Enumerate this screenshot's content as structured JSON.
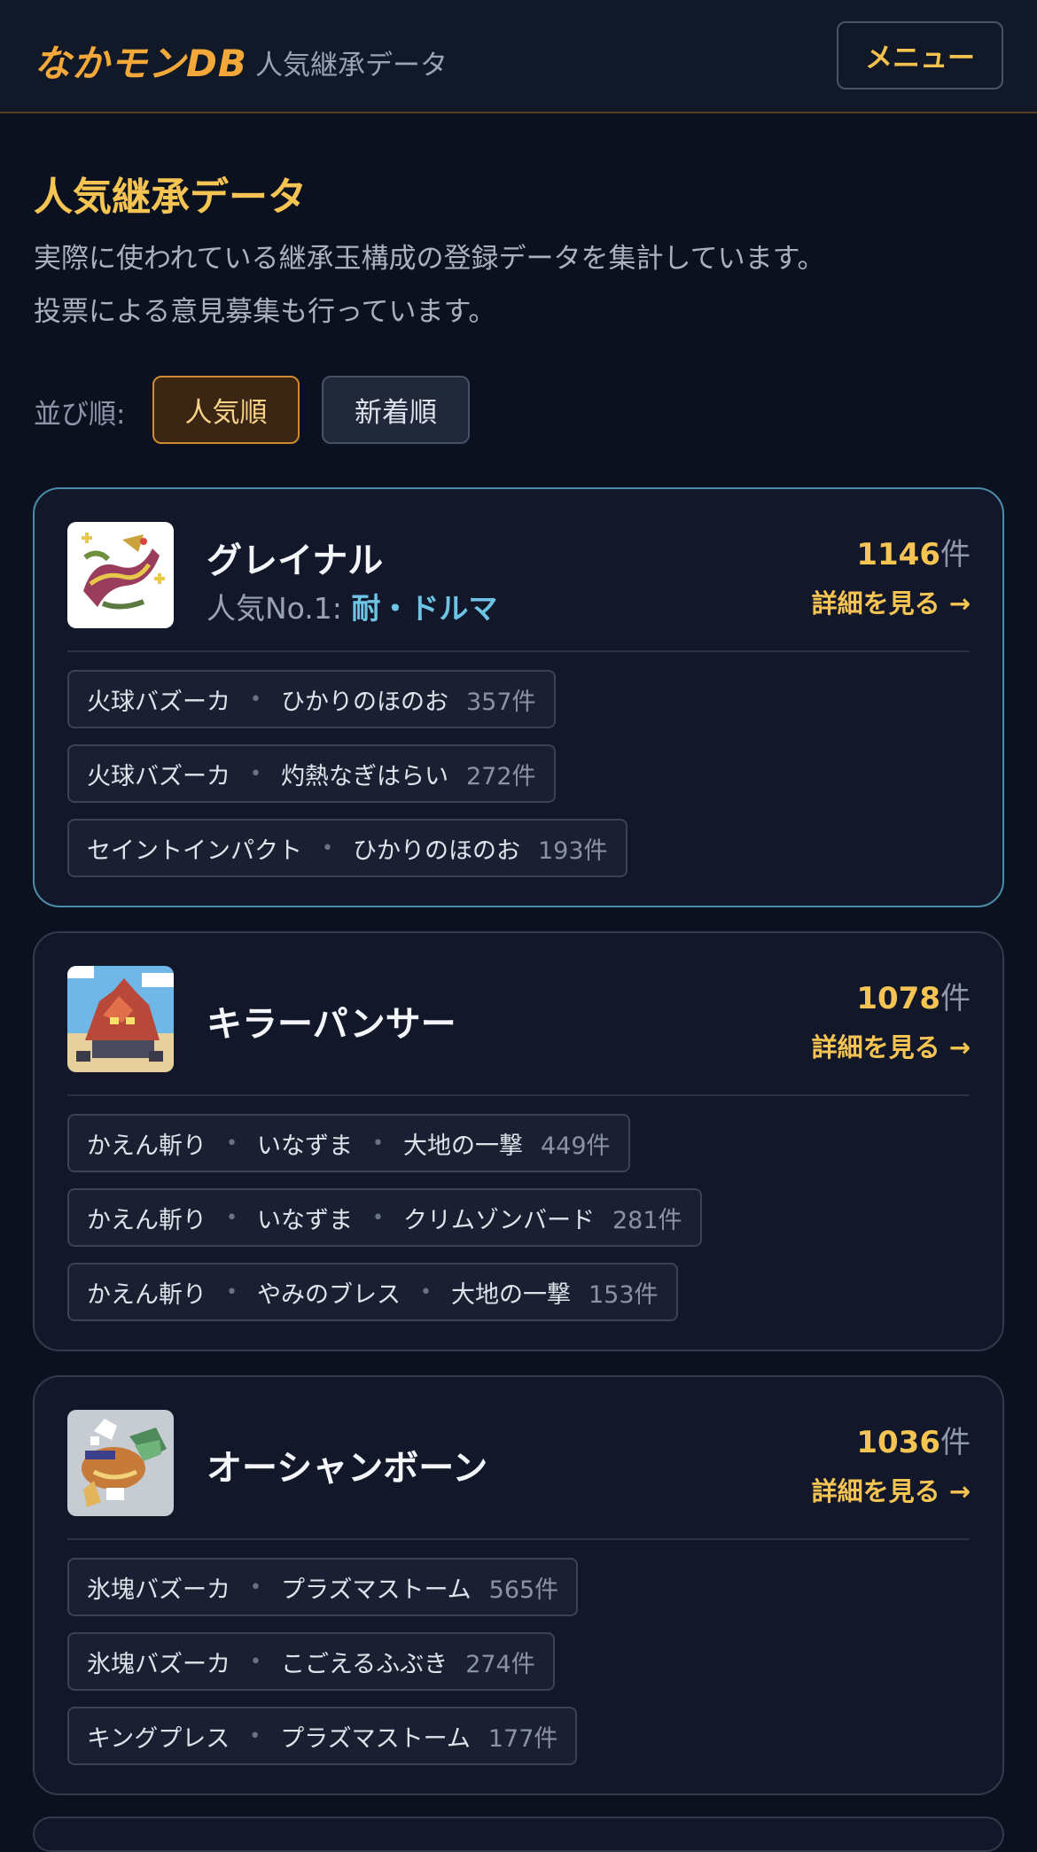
{
  "header": {
    "logo": "なかモンDB",
    "subtitle": "人気継承データ",
    "menu_label": "メニュー"
  },
  "page": {
    "title": "人気継承データ",
    "description_line1": "実際に使われている継承玉構成の登録データを集計しています。",
    "description_line2": "投票による意見募集も行っています。"
  },
  "sort": {
    "label": "並び順:",
    "popular": "人気順",
    "newest": "新着順",
    "selected": "人気順"
  },
  "count_unit": "件",
  "detail_label": "詳細を見る →",
  "cards": [
    {
      "name": "グレイナル",
      "popular_prefix": "人気No.1: ",
      "popular_value": "耐・ドルマ",
      "count": "1146",
      "combos": [
        {
          "skills": [
            "火球バズーカ",
            "ひかりのほのお"
          ],
          "count": "357件"
        },
        {
          "skills": [
            "火球バズーカ",
            "灼熱なぎはらい"
          ],
          "count": "272件"
        },
        {
          "skills": [
            "セイントインパクト",
            "ひかりのほのお"
          ],
          "count": "193件"
        }
      ]
    },
    {
      "name": "キラーパンサー",
      "count": "1078",
      "combos": [
        {
          "skills": [
            "かえん斬り",
            "いなずま",
            "大地の一撃"
          ],
          "count": "449件"
        },
        {
          "skills": [
            "かえん斬り",
            "いなずま",
            "クリムゾンバード"
          ],
          "count": "281件"
        },
        {
          "skills": [
            "かえん斬り",
            "やみのブレス",
            "大地の一撃"
          ],
          "count": "153件"
        }
      ]
    },
    {
      "name": "オーシャンボーン",
      "count": "1036",
      "combos": [
        {
          "skills": [
            "氷塊バズーカ",
            "プラズマストーム"
          ],
          "count": "565件"
        },
        {
          "skills": [
            "氷塊バズーカ",
            "こごえるふぶき"
          ],
          "count": "274件"
        },
        {
          "skills": [
            "キングプレス",
            "プラズマストーム"
          ],
          "count": "177件"
        }
      ]
    }
  ]
}
